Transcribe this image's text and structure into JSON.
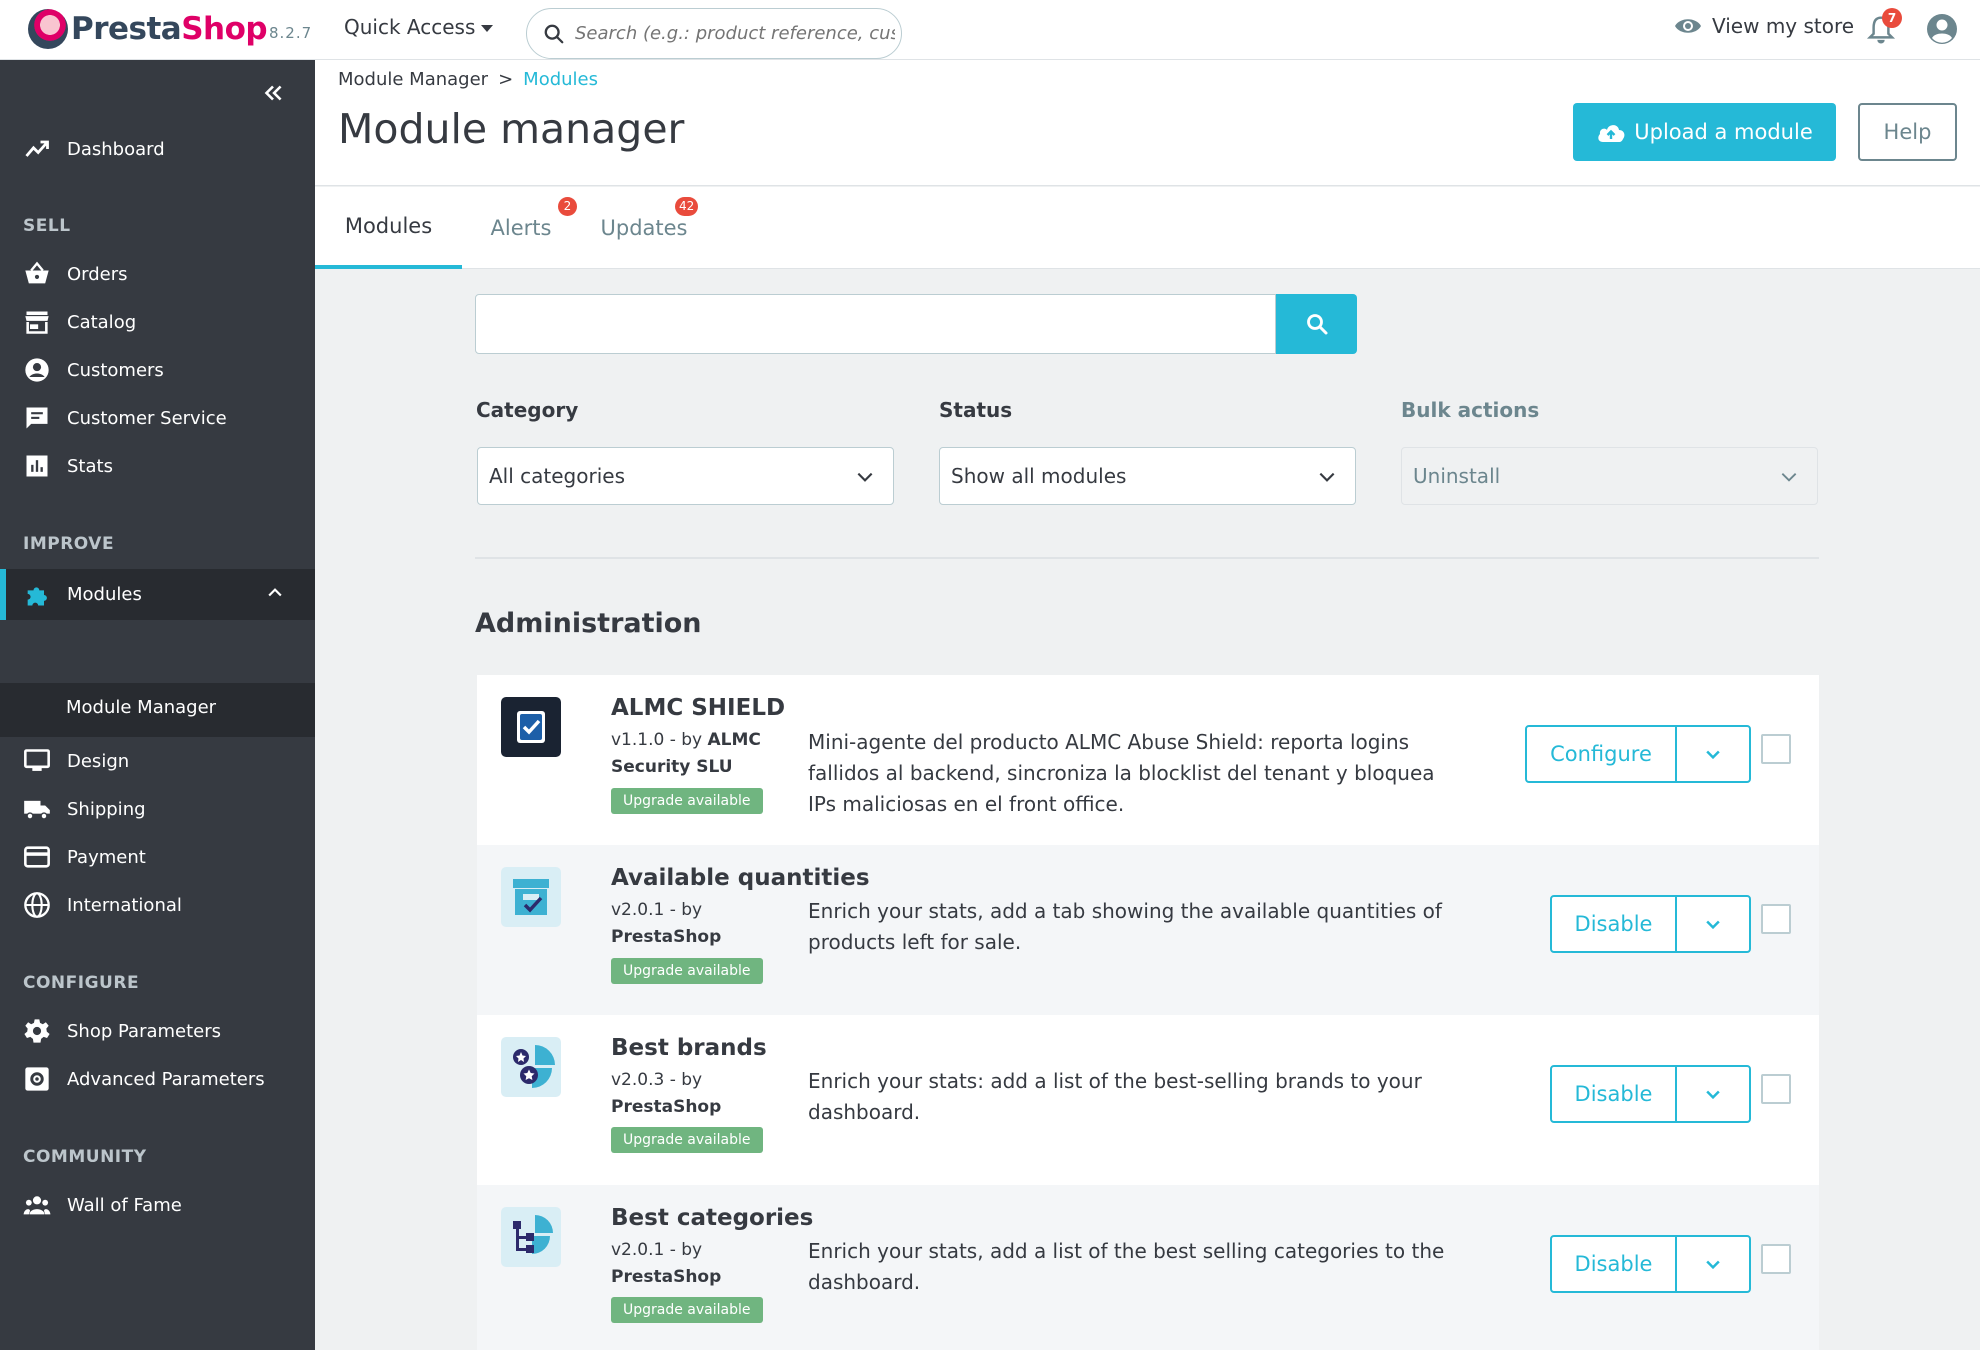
{
  "header": {
    "logo_brand_a": "Presta",
    "logo_brand_b": "Shop",
    "version": "8.2.7",
    "quick_access": "Quick Access",
    "search_placeholder": "Search (e.g.: product reference, custon",
    "view_store": "View my store",
    "notifications_count": "7"
  },
  "sidebar": {
    "dashboard": "Dashboard",
    "sections": {
      "sell": "SELL",
      "improve": "IMPROVE",
      "configure": "CONFIGURE",
      "community": "COMMUNITY"
    },
    "sell_items": [
      "Orders",
      "Catalog",
      "Customers",
      "Customer Service",
      "Stats"
    ],
    "modules": "Modules",
    "module_manager": "Module Manager",
    "improve_items": [
      "Design",
      "Shipping",
      "Payment",
      "International"
    ],
    "configure_items": [
      "Shop Parameters",
      "Advanced Parameters"
    ],
    "community_items": [
      "Wall of Fame"
    ]
  },
  "page": {
    "breadcrumb": {
      "parent": "Module Manager",
      "separator": ">",
      "current": "Modules"
    },
    "title": "Module manager",
    "upload_button": "Upload a module",
    "help_button": "Help"
  },
  "tabs": [
    {
      "label": "Modules",
      "badge": ""
    },
    {
      "label": "Alerts",
      "badge": "2"
    },
    {
      "label": "Updates",
      "badge": "42"
    }
  ],
  "filters": {
    "search_value": "",
    "category_label": "Category",
    "category_value": "All categories",
    "status_label": "Status",
    "status_value": "Show all modules",
    "bulk_label": "Bulk actions",
    "bulk_value": "Uninstall"
  },
  "section_title": "Administration",
  "modules": [
    {
      "name": "ALMC SHIELD",
      "version": "v1.1.0 - by",
      "author": "ALMC Security SLU",
      "badge": "Upgrade available",
      "description": "Mini-agente del producto ALMC Abuse Shield: reporta logins fallidos al backend, sincroniza la blocklist del tenant y bloquea IPs maliciosas en el front office.",
      "action": "Configure",
      "icon": "shield-check-icon"
    },
    {
      "name": "Available quantities",
      "version": "v2.0.1 - by",
      "author": "PrestaShop",
      "badge": "Upgrade available",
      "description": "Enrich your stats, add a tab showing the available quantities of products left for sale.",
      "action": "Disable",
      "icon": "stock-boxes-icon"
    },
    {
      "name": "Best brands",
      "version": "v2.0.3 - by",
      "author": "PrestaShop",
      "badge": "Upgrade available",
      "description": "Enrich your stats: add a list of the best-selling brands to your dashboard.",
      "action": "Disable",
      "icon": "star-pie-icon"
    },
    {
      "name": "Best categories",
      "version": "v2.0.1 - by",
      "author": "PrestaShop",
      "badge": "Upgrade available",
      "description": "Enrich your stats, add a list of the best selling categories to the dashboard.",
      "action": "Disable",
      "icon": "category-tree-icon"
    }
  ],
  "colors": {
    "accent": "#25b9d7",
    "sidebar": "#363a41",
    "badge_red": "#e94b3c",
    "upgrade_green": "#70b580",
    "brand_pink": "#df0067"
  }
}
